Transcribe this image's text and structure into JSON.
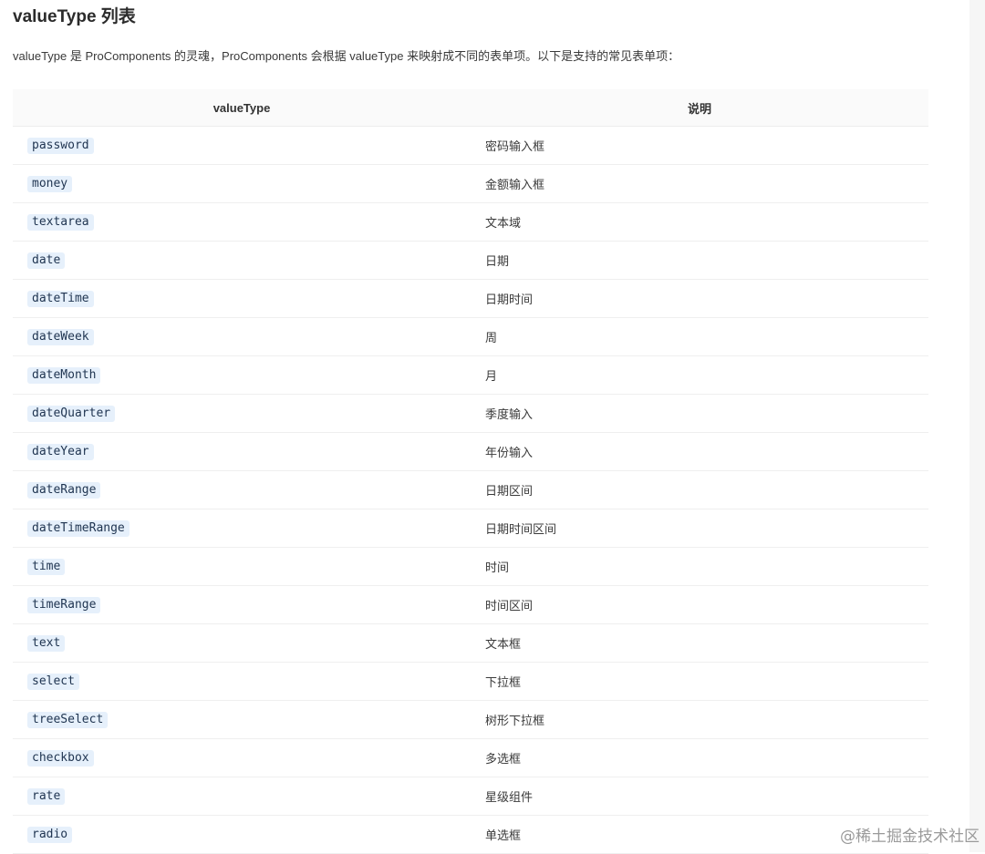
{
  "title": "valueType 列表",
  "intro": "valueType 是 ProComponents 的灵魂，ProComponents 会根据 valueType 来映射成不同的表单项。以下是支持的常见表单项：",
  "table": {
    "headers": [
      "valueType",
      "说明"
    ],
    "rows": [
      {
        "type": "password",
        "desc": "密码输入框"
      },
      {
        "type": "money",
        "desc": "金额输入框"
      },
      {
        "type": "textarea",
        "desc": "文本域"
      },
      {
        "type": "date",
        "desc": "日期"
      },
      {
        "type": "dateTime",
        "desc": "日期时间"
      },
      {
        "type": "dateWeek",
        "desc": "周"
      },
      {
        "type": "dateMonth",
        "desc": "月"
      },
      {
        "type": "dateQuarter",
        "desc": "季度输入"
      },
      {
        "type": "dateYear",
        "desc": "年份输入"
      },
      {
        "type": "dateRange",
        "desc": "日期区间"
      },
      {
        "type": "dateTimeRange",
        "desc": "日期时间区间"
      },
      {
        "type": "time",
        "desc": "时间"
      },
      {
        "type": "timeRange",
        "desc": "时间区间"
      },
      {
        "type": "text",
        "desc": "文本框"
      },
      {
        "type": "select",
        "desc": "下拉框"
      },
      {
        "type": "treeSelect",
        "desc": "树形下拉框"
      },
      {
        "type": "checkbox",
        "desc": "多选框"
      },
      {
        "type": "rate",
        "desc": "星级组件"
      },
      {
        "type": "radio",
        "desc": "单选框"
      }
    ]
  },
  "watermark": "@稀土掘金技术社区",
  "colors": {
    "code_background": "#e6f0fb",
    "header_background": "#fafafa"
  }
}
